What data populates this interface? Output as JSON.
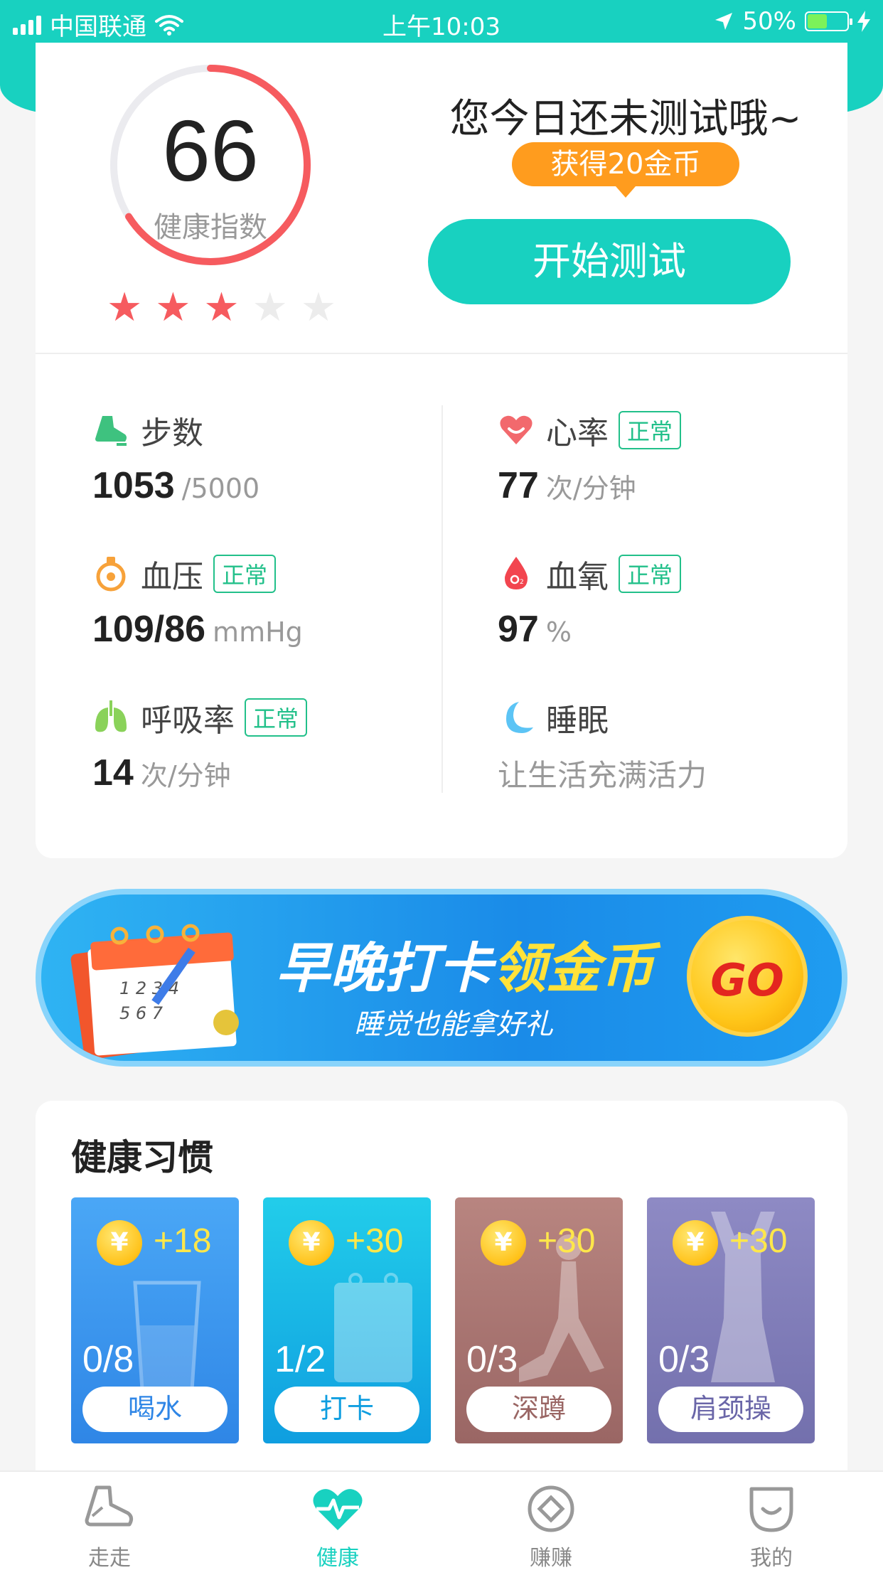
{
  "status_bar": {
    "carrier": "中国联通",
    "time": "上午10:03",
    "battery": "50%"
  },
  "score": {
    "value": "66",
    "label": "健康指数",
    "progress_fraction": 0.66,
    "stars_on": 3,
    "stars_total": 5
  },
  "test": {
    "message": "您今日还未测试哦~",
    "reward_badge": "获得20金币",
    "start_button": "开始测试"
  },
  "metrics": {
    "steps": {
      "name": "步数",
      "value": "1053",
      "unit": "/5000",
      "icon": "shoe-icon"
    },
    "heart": {
      "name": "心率",
      "badge": "正常",
      "value": "77",
      "unit": "次/分钟",
      "icon": "heart-icon"
    },
    "pressure": {
      "name": "血压",
      "badge": "正常",
      "value": "109/86",
      "unit": "mmHg",
      "icon": "pressure-icon"
    },
    "oxygen": {
      "name": "血氧",
      "badge": "正常",
      "value": "97",
      "unit": "%",
      "icon": "oxygen-drop-icon"
    },
    "breath": {
      "name": "呼吸率",
      "badge": "正常",
      "value": "14",
      "unit": "次/分钟",
      "icon": "lungs-icon"
    },
    "sleep": {
      "name": "睡眠",
      "subtitle": "让生活充满活力",
      "icon": "moon-icon"
    }
  },
  "banner": {
    "title_part1": "早晚打卡",
    "title_part2": "领金币",
    "subtitle": "睡觉也能拿好礼",
    "go_label": "GO"
  },
  "habits": {
    "title": "健康习惯",
    "coin_symbol": "¥",
    "items": [
      {
        "reward": "+18",
        "progress": "0/8",
        "action": "喝水",
        "color": "#3b9cf4"
      },
      {
        "reward": "+30",
        "progress": "1/2",
        "action": "打卡",
        "color": "#14b5e8"
      },
      {
        "reward": "+30",
        "progress": "0/3",
        "action": "深蹲",
        "color": "#a0706e"
      },
      {
        "reward": "+30",
        "progress": "0/3",
        "action": "肩颈操",
        "color": "#7f7bb8"
      }
    ]
  },
  "tabbar": {
    "items": [
      {
        "label": "走走",
        "icon": "shoe-icon"
      },
      {
        "label": "健康",
        "icon": "heartbeat-icon"
      },
      {
        "label": "赚赚",
        "icon": "diamond-coin-icon"
      },
      {
        "label": "我的",
        "icon": "smile-face-icon"
      }
    ],
    "active_index": 1,
    "active_color": "#18d1c0"
  },
  "colors": {
    "brand": "#18d1c0",
    "badge_orange": "#ff9c1e",
    "normal_green": "#22c08a",
    "ring_red": "#f65b5f"
  }
}
